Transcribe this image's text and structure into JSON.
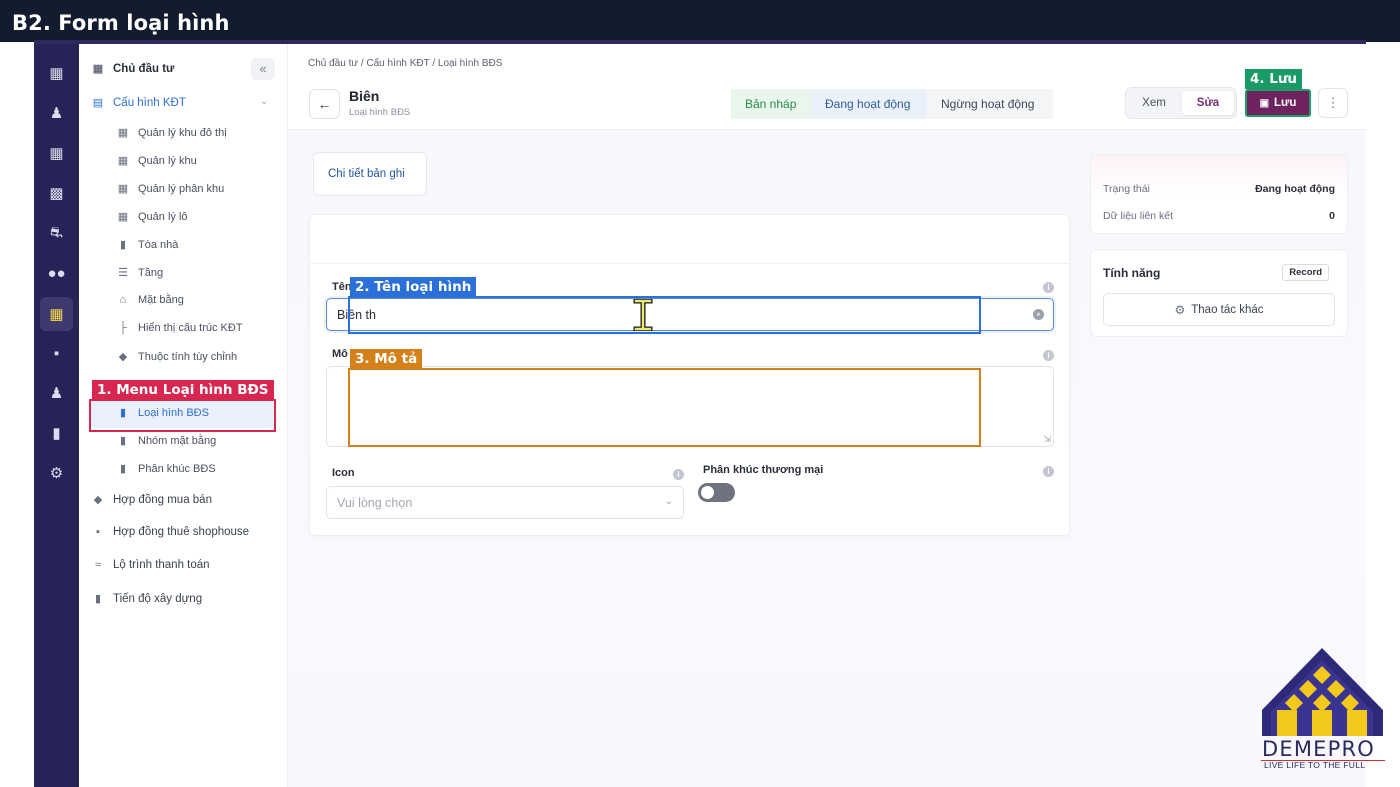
{
  "banner": {
    "title": "B2. Form loại hình"
  },
  "sidebar": {
    "collapse": "«",
    "top_items": [
      {
        "label": "Chủ đầu tư",
        "icon": "building-icon"
      },
      {
        "label": "Cấu hình KĐT",
        "icon": "bank-icon"
      }
    ],
    "sub_items": [
      {
        "label": "Quản lý khu đô thị"
      },
      {
        "label": "Quản lý khu"
      },
      {
        "label": "Quản lý phân khu"
      },
      {
        "label": "Quản lý lô"
      },
      {
        "label": "Tòa nhà"
      },
      {
        "label": "Tầng"
      },
      {
        "label": "Mặt bằng"
      },
      {
        "label": "Hiển thị cấu trúc KĐT"
      },
      {
        "label": "Thuộc tính tùy chỉnh"
      },
      {
        "label": "Loại hình BĐS"
      },
      {
        "label": "Nhóm mặt bằng"
      },
      {
        "label": "Phân khúc BĐS"
      }
    ],
    "bottom_items": [
      {
        "label": "Hợp đồng mua bán"
      },
      {
        "label": "Hợp đồng thuê shophouse"
      },
      {
        "label": "Lộ trình thanh toán"
      },
      {
        "label": "Tiến độ xây dựng"
      }
    ]
  },
  "header": {
    "breadcrumb": "Chủ đầu tư  /  Cấu hình KĐT  /  Loại hình BĐS",
    "title": "Biên",
    "subtitle": "Loại hình BĐS",
    "status_steps": [
      "Bản nháp",
      "Đang hoạt động",
      "Ngừng hoạt động"
    ],
    "view_label": "Xem",
    "edit_label": "Sửa",
    "save_label": "Lưu"
  },
  "tabs": {
    "detail_label": "Chi tiết bản ghi"
  },
  "form": {
    "name_label": "Tên",
    "name_value": "Biên th",
    "desc_label": "Mô",
    "icon_label": "Icon",
    "icon_placeholder": "Vui lòng chọn",
    "commercial_label": "Phân khúc thương mại"
  },
  "status_panel": {
    "status_label": "Trạng thái",
    "status_value": "Đang hoạt động",
    "linked_label": "Dữ liệu liên kết",
    "linked_value": "0"
  },
  "feature_panel": {
    "title": "Tính năng",
    "badge": "Record",
    "action_label": "Thao tác khác"
  },
  "annotations": {
    "menu": "1. Menu Loại hình BĐS",
    "name": "2. Tên loại hình",
    "desc": "3. Mô tả",
    "save": "4. Lưu"
  },
  "logo": {
    "name": "DEMEPRO",
    "tagline": "LIVE LIFE TO THE FULL"
  },
  "colors": {
    "annotation_red": "#d7264f",
    "annotation_blue": "#2b6fd8",
    "annotation_orange": "#d4811c",
    "annotation_green": "#1a9a66",
    "save_purple": "#6e2260"
  }
}
